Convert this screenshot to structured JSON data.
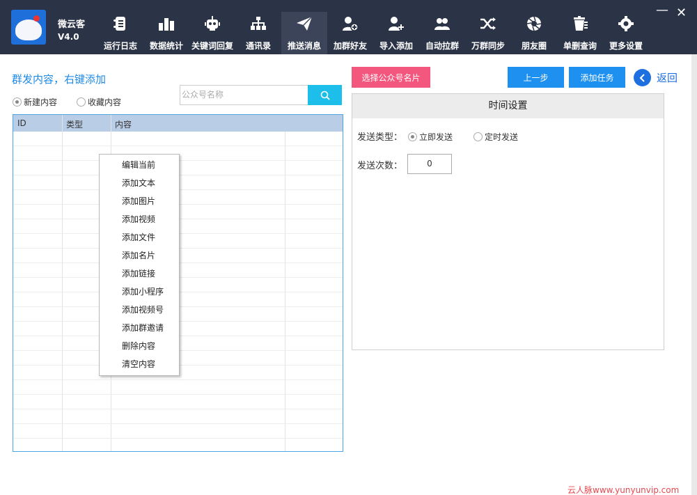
{
  "app": {
    "name": "微云客",
    "version": "V4.0"
  },
  "nav": [
    {
      "label": "运行日志",
      "icon": "log-icon"
    },
    {
      "label": "数据统计",
      "icon": "bar-chart-icon"
    },
    {
      "label": "关键词回复",
      "icon": "robot-icon"
    },
    {
      "label": "通讯录",
      "icon": "org-tree-icon"
    },
    {
      "label": "推送消息",
      "icon": "paper-plane-icon",
      "active": true
    },
    {
      "label": "加群好友",
      "icon": "user-add-icon"
    },
    {
      "label": "导入添加",
      "icon": "user-plus-icon"
    },
    {
      "label": "自动拉群",
      "icon": "group-icon"
    },
    {
      "label": "万群同步",
      "icon": "shuffle-icon"
    },
    {
      "label": "朋友圈",
      "icon": "aperture-icon"
    },
    {
      "label": "单删查询",
      "icon": "trash-icon"
    },
    {
      "label": "更多设置",
      "icon": "gear-icon"
    }
  ],
  "left": {
    "title": "群发内容，右键添加",
    "radio_new": "新建内容",
    "radio_fav": "收藏内容",
    "search_placeholder": "公众号名称",
    "columns": [
      "ID",
      "类型",
      "内容"
    ]
  },
  "context_menu": [
    "编辑当前",
    "添加文本",
    "添加图片",
    "添加视频",
    "添加文件",
    "添加名片",
    "添加链接",
    "添加小程序",
    "添加视频号",
    "添加群邀请",
    "删除内容",
    "清空内容"
  ],
  "right": {
    "select_card_button": "选择公众号名片",
    "prev_button": "上一步",
    "add_task_button": "添加任务",
    "back_label": "返回",
    "time_settings_title": "时间设置",
    "send_type_label": "发送类型：",
    "send_now": "立即发送",
    "send_timed": "定时发送",
    "send_count_label": "发送次数：",
    "send_count_value": "0"
  },
  "watermark": "云人脉www.yunyunvip.com",
  "colors": {
    "topbar": "#2b3346",
    "accent_blue": "#1e90f0",
    "pink": "#f3577e",
    "search_button": "#1dbfea",
    "title_blue": "#1e8ae6"
  }
}
